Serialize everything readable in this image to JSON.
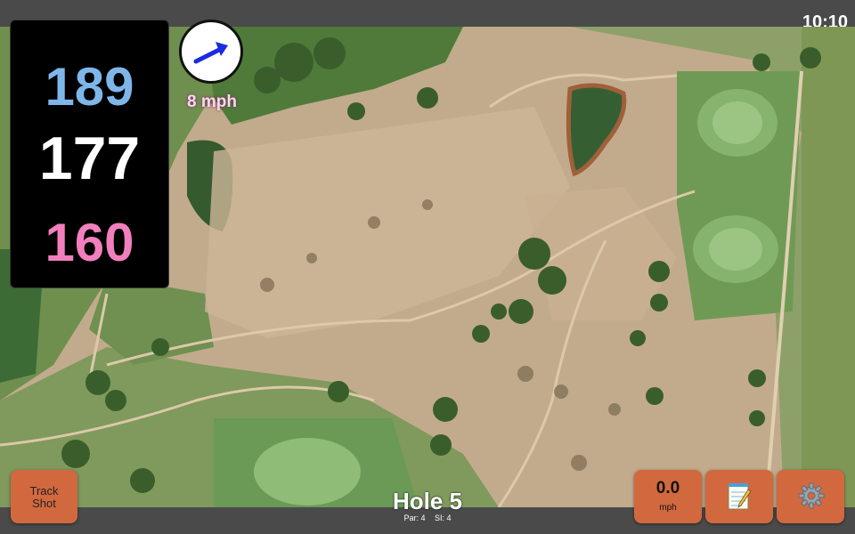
{
  "status": {
    "clock": "10:10"
  },
  "distances": {
    "back": "189",
    "center": "177",
    "front": "160"
  },
  "colors": {
    "back": "#7fb6ea",
    "center": "#ffffff",
    "front": "#f27fbd",
    "button": "#d2693e",
    "arrow": "#1a2be0"
  },
  "wind": {
    "speed": "8 mph",
    "arrow_icon": "wind-direction-arrow"
  },
  "buttons": {
    "track_line1": "Track",
    "track_line2": "Shot",
    "speed_value": "0.0",
    "speed_unit": "mph",
    "notes_icon": "notepad-icon",
    "settings_icon": "gear-icon"
  },
  "hole": {
    "title": "Hole 5",
    "par": "Par: 4",
    "si": "SI: 4"
  }
}
